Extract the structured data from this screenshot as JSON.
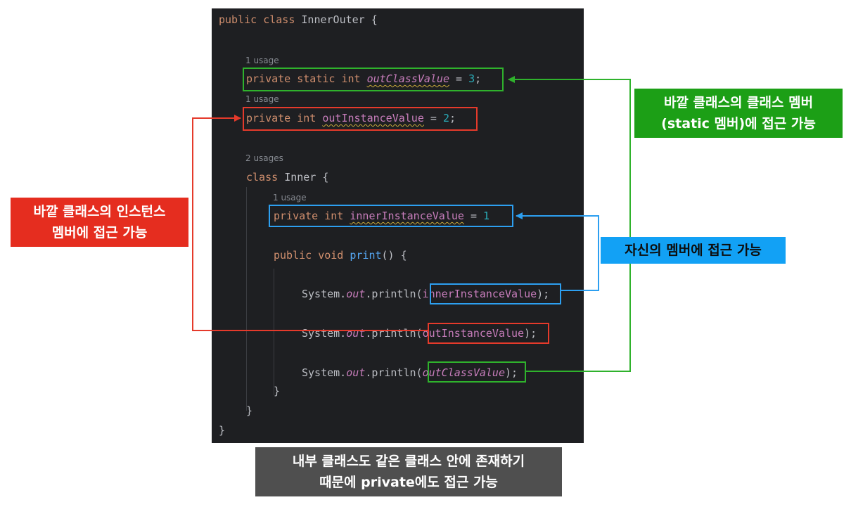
{
  "code": {
    "line1": {
      "kw1": "public",
      "kw2": "class",
      "name": "InnerOuter",
      "brace": "{"
    },
    "usage1": "1 usage",
    "line2": {
      "kw1": "private",
      "kw2": "static",
      "kw3": "int",
      "field": "outClassValue",
      "eq": "=",
      "num": "3",
      "semi": ";"
    },
    "usage2": "1 usage",
    "line3": {
      "kw1": "private",
      "kw2": "int",
      "field": "outInstanceValue",
      "eq": "=",
      "num": "2",
      "semi": ";"
    },
    "usage3": "2 usages",
    "line4": {
      "kw": "class",
      "name": "Inner",
      "brace": "{"
    },
    "usage4": "1 usage",
    "line5": {
      "kw1": "private",
      "kw2": "int",
      "field": "innerInstanceValue",
      "eq": "=",
      "num": "1"
    },
    "line6": {
      "kw1": "public",
      "kw2": "void",
      "fn": "print",
      "rest": "() {"
    },
    "line7": {
      "sys": "System.",
      "out": "out",
      "println": ".println(",
      "arg": "innerInstanceValue",
      "end": ");"
    },
    "line8": {
      "sys": "System.",
      "out": "out",
      "println": ".println(",
      "arg": "outInstanceValue",
      "end": ");"
    },
    "line9": {
      "sys": "System.",
      "out": "out",
      "println": ".println(",
      "arg": "outClassValue",
      "end": ");"
    },
    "close1": "}",
    "close2": "}",
    "close3": "}"
  },
  "notes": {
    "green": {
      "line1": "바깥 클래스의 클래스 멤버",
      "line2": "(static 멤버)에 접근 가능"
    },
    "red": {
      "line1": "바깥 클래스의 인스턴스",
      "line2": "멤버에 접근 가능"
    },
    "blue": {
      "line1": "자신의 멤버에 접근 가능"
    },
    "gray": {
      "line1": "내부 클래스도 같은 클래스 안에 존재하기",
      "line2": "때문에 private에도 접근 가능"
    }
  },
  "colors": {
    "green": "#2fb22c",
    "red": "#e53a2b",
    "blue": "#2d9ff0",
    "panel": "#1e1f22"
  }
}
